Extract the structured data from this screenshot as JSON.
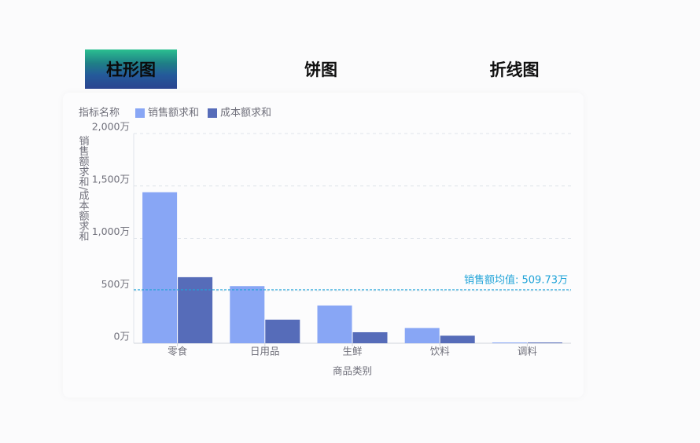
{
  "tabs": [
    {
      "label": "柱形图",
      "active": true
    },
    {
      "label": "饼图",
      "active": false
    },
    {
      "label": "折线图",
      "active": false
    }
  ],
  "colors": {
    "series1": "#88a6f5",
    "series2": "#566cb9",
    "avg_line": "#1fa3d8",
    "text": "#6f6f7a"
  },
  "chart_data": {
    "type": "bar",
    "legend_title": "指标名称",
    "legend_position": "top-left",
    "categories": [
      "零食",
      "日用品",
      "生鲜",
      "饮料",
      "调料"
    ],
    "series": [
      {
        "name": "销售额求和",
        "values": [
          1440,
          545,
          360,
          145,
          4
        ]
      },
      {
        "name": "成本额求和",
        "values": [
          630,
          225,
          105,
          72,
          3
        ]
      }
    ],
    "xlabel": "商品类别",
    "ylabel": "销售额求和/成本额求和",
    "ylim": [
      0,
      2000
    ],
    "y_ticks": [
      {
        "value": 0,
        "label": "0万"
      },
      {
        "value": 500,
        "label": "500万"
      },
      {
        "value": 1000,
        "label": "1,000万"
      },
      {
        "value": 1500,
        "label": "1,500万"
      },
      {
        "value": 2000,
        "label": "2,000万"
      }
    ],
    "grid": true,
    "reference_line": {
      "value": 509.73,
      "label": "销售额均值: 509.73万"
    }
  }
}
